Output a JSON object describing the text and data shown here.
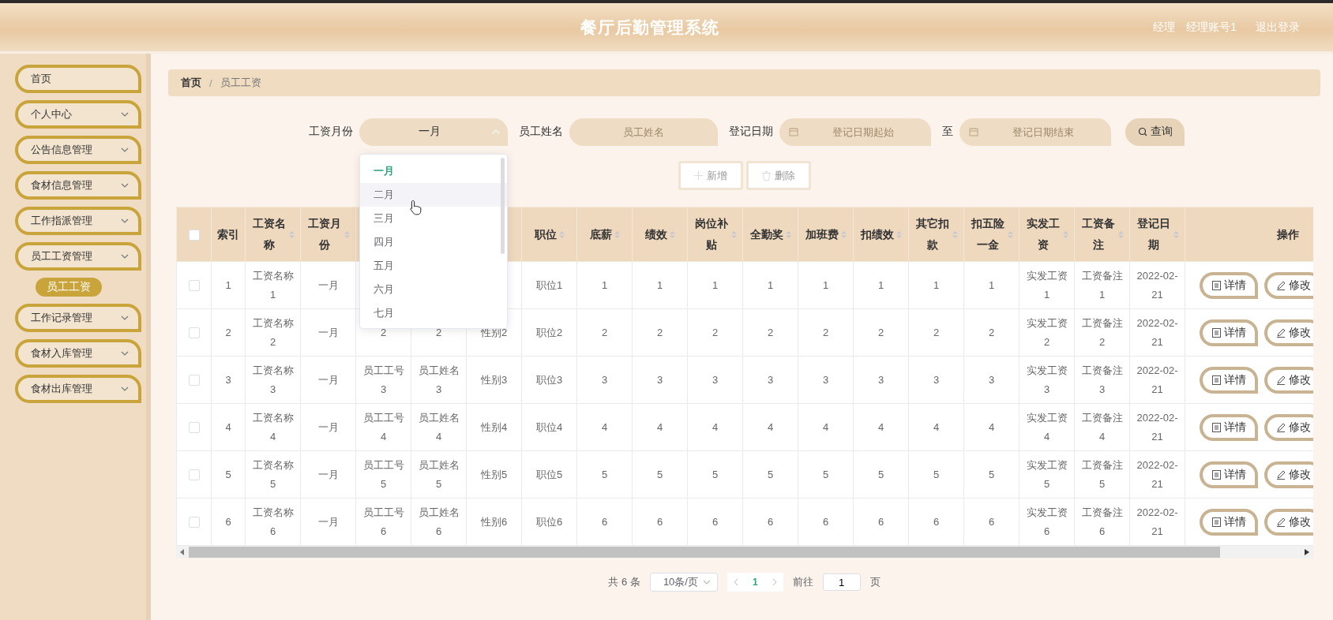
{
  "header": {
    "title": "餐厅后勤管理系统",
    "role": "经理",
    "username": "经理账号1",
    "logout": "退出登录"
  },
  "sidebar": {
    "items": [
      {
        "label": "首页",
        "kind": "link"
      },
      {
        "label": "个人中心",
        "kind": "menu"
      },
      {
        "label": "公告信息管理",
        "kind": "menu"
      },
      {
        "label": "食材信息管理",
        "kind": "menu"
      },
      {
        "label": "工作指派管理",
        "kind": "menu"
      },
      {
        "label": "员工工资管理",
        "kind": "menu",
        "children": [
          {
            "label": "员工工资",
            "selected": true
          }
        ]
      },
      {
        "label": "工作记录管理",
        "kind": "menu"
      },
      {
        "label": "食材入库管理",
        "kind": "menu"
      },
      {
        "label": "食材出库管理",
        "kind": "menu"
      }
    ]
  },
  "breadcrumb": [
    {
      "label": "首页",
      "current": false
    },
    {
      "label": "员工工资",
      "current": true
    }
  ],
  "breadcrumb_separator": "/",
  "search": {
    "fields": [
      {
        "kind": "select",
        "label": "工资月份",
        "value": "一月",
        "open": true
      },
      {
        "kind": "text",
        "label": "员工姓名",
        "placeholder": "员工姓名"
      },
      {
        "kind": "date",
        "label": "登记日期",
        "placeholder": "登记日期起始"
      },
      {
        "kind": "date",
        "label": "至",
        "placeholder": "登记日期结束"
      }
    ],
    "button": "查询"
  },
  "month_dropdown": {
    "options": [
      {
        "label": "一月",
        "selected": true,
        "hovered": false
      },
      {
        "label": "二月",
        "selected": false,
        "hovered": true
      },
      {
        "label": "三月",
        "selected": false,
        "hovered": false
      },
      {
        "label": "四月",
        "selected": false,
        "hovered": false
      },
      {
        "label": "五月",
        "selected": false,
        "hovered": false
      },
      {
        "label": "六月",
        "selected": false,
        "hovered": false
      },
      {
        "label": "七月",
        "selected": false,
        "hovered": false
      }
    ]
  },
  "actions": [
    {
      "label": "新增",
      "kind": "add"
    },
    {
      "label": "删除",
      "kind": "delete"
    }
  ],
  "table": {
    "all_checked": false,
    "columns": [
      {
        "label": "索引",
        "sortable": false
      },
      {
        "label": "工资名称",
        "sortable": true
      },
      {
        "label": "工资月份",
        "sortable": true
      },
      null,
      null,
      null,
      {
        "label": "职位",
        "sortable": true
      },
      {
        "label": "底薪",
        "sortable": true
      },
      {
        "label": "绩效",
        "sortable": true
      },
      {
        "label": "岗位补贴",
        "sortable": true
      },
      {
        "label": "全勤奖",
        "sortable": true
      },
      {
        "label": "加班费",
        "sortable": true
      },
      {
        "label": "扣绩效",
        "sortable": true
      },
      {
        "label": "其它扣款",
        "sortable": true
      },
      {
        "label": "扣五险一金",
        "sortable": true
      },
      {
        "label": "实发工资",
        "sortable": true
      },
      {
        "label": "工资备注",
        "sortable": true
      },
      {
        "label": "登记日期",
        "sortable": true
      },
      {
        "label": "操作",
        "sortable": false
      }
    ],
    "rows": [
      {
        "checked": false,
        "cells": [
          "1",
          "工资名称1",
          "一月",
          null,
          null,
          null,
          "职位1",
          "1",
          "1",
          "1",
          "1",
          "1",
          "1",
          "1",
          "1",
          "实发工资1",
          "工资备注1",
          "2022-02-21"
        ],
        "actions": [
          "详情",
          "修改"
        ]
      },
      {
        "checked": false,
        "cells": [
          "2",
          "工资名称2",
          "一月",
          "2",
          "2",
          "性别2",
          "职位2",
          "2",
          "2",
          "2",
          "2",
          "2",
          "2",
          "2",
          "2",
          "实发工资2",
          "工资备注2",
          "2022-02-21"
        ],
        "actions": [
          "详情",
          "修改"
        ]
      },
      {
        "checked": false,
        "cells": [
          "3",
          "工资名称3",
          "一月",
          "员工工号3",
          "员工姓名3",
          "性别3",
          "职位3",
          "3",
          "3",
          "3",
          "3",
          "3",
          "3",
          "3",
          "3",
          "实发工资3",
          "工资备注3",
          "2022-02-21"
        ],
        "actions": [
          "详情",
          "修改"
        ]
      },
      {
        "checked": false,
        "cells": [
          "4",
          "工资名称4",
          "一月",
          "员工工号4",
          "员工姓名4",
          "性别4",
          "职位4",
          "4",
          "4",
          "4",
          "4",
          "4",
          "4",
          "4",
          "4",
          "实发工资4",
          "工资备注4",
          "2022-02-21"
        ],
        "actions": [
          "详情",
          "修改"
        ]
      },
      {
        "checked": false,
        "cells": [
          "5",
          "工资名称5",
          "一月",
          "员工工号5",
          "员工姓名5",
          "性别5",
          "职位5",
          "5",
          "5",
          "5",
          "5",
          "5",
          "5",
          "5",
          "5",
          "实发工资5",
          "工资备注5",
          "2022-02-21"
        ],
        "actions": [
          "详情",
          "修改"
        ]
      },
      {
        "checked": false,
        "cells": [
          "6",
          "工资名称6",
          "一月",
          "员工工号6",
          "员工姓名6",
          "性别6",
          "职位6",
          "6",
          "6",
          "6",
          "6",
          "6",
          "6",
          "6",
          "6",
          "实发工资6",
          "工资备注6",
          "2022-02-21"
        ],
        "actions": [
          "详情",
          "修改"
        ]
      }
    ]
  },
  "pagination": {
    "total": "共 6 条",
    "page_size": "10条/页",
    "pages": [
      {
        "label": "1",
        "selected": true
      }
    ],
    "goto_label": "前往",
    "goto_value": "1",
    "goto_suffix": "页"
  }
}
